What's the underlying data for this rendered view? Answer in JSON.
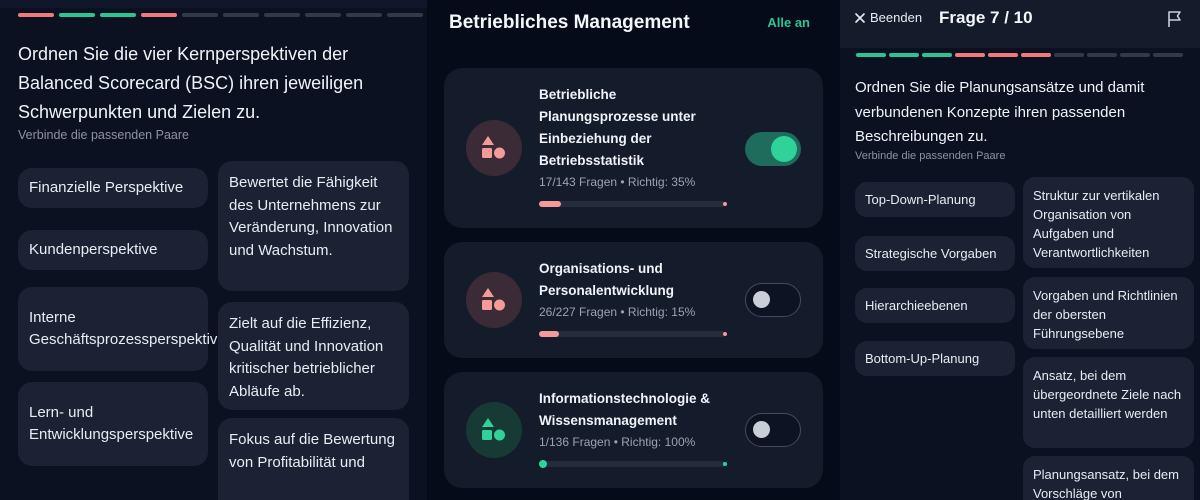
{
  "colors": {
    "correct": "#2fc48f",
    "wrong": "#f07a7a",
    "pending": "#323a4a",
    "accent": "#2fd39a"
  },
  "left": {
    "progress": [
      "wrong",
      "correct",
      "correct",
      "wrong",
      "pending",
      "pending",
      "pending",
      "pending",
      "pending",
      "pending"
    ],
    "question": "Ordnen Sie die vier Kernperspektiven der Balanced Scorecard (BSC) ihren jeweiligen Schwerpunkten und Zielen zu.",
    "hint": "Verbinde die passenden Paare",
    "terms": [
      "Finanzielle Perspektive",
      "Kundenperspektive",
      "Interne Geschäftsprozessperspektive",
      "Lern- und Entwicklungsperspektive"
    ],
    "descriptions": [
      "Bewertet die Fähigkeit des Unternehmens zur Veränderung, Innovation und Wachstum.",
      "Zielt auf die Effizienz, Qualität und Innovation kritischer betrieblicher Abläufe ab.",
      "Fokus auf die Bewertung von Profitabilität und"
    ]
  },
  "middle": {
    "title": "Betriebliches Management",
    "all_on": "Alle an",
    "cards": [
      {
        "title": "Betriebliche Planungsprozesse unter Einbeziehung der Betriebsstatistik",
        "meta": "17/143 Fragen • Richtig: 35%",
        "progress": 0.12,
        "enabled": true,
        "icon": "shapes-icon",
        "icon_color": "#f59a9a",
        "bar_color": "#f59a9a"
      },
      {
        "title": "Organisations- und Personalentwicklung",
        "meta": "26/227 Fragen • Richtig: 15%",
        "progress": 0.11,
        "enabled": false,
        "icon": "shapes-icon",
        "icon_color": "#f59a9a",
        "bar_color": "#f59a9a"
      },
      {
        "title": "Informationstechnologie & Wissensmanagement",
        "meta": "1/136 Fragen • Richtig: 100%",
        "progress": 0.01,
        "enabled": false,
        "icon": "shapes-icon",
        "icon_color": "#2fd39a",
        "bar_color": "#2fd39a"
      }
    ]
  },
  "right": {
    "quit_label": "Beenden",
    "question_counter": "Frage 7 / 10",
    "progress": [
      "correct",
      "correct",
      "correct",
      "wrong",
      "wrong",
      "wrong",
      "pending",
      "pending",
      "pending",
      "pending"
    ],
    "question": "Ordnen Sie die Planungsansätze und damit verbundenen Konzepte ihren passenden Beschreibungen zu.",
    "hint": "Verbinde die passenden Paare",
    "terms": [
      "Top-Down-Planung",
      "Strategische Vorgaben",
      "Hierarchieebenen",
      "Bottom-Up-Planung"
    ],
    "descriptions": [
      "Struktur zur vertikalen Organisation von Aufgaben und Verantwortlichkeiten",
      "Vorgaben und Richtlinien der obersten Führungsebene",
      "Ansatz, bei dem übergeordnete Ziele nach unten detailliert werden",
      "Planungsansatz, bei dem Vorschläge von"
    ]
  }
}
